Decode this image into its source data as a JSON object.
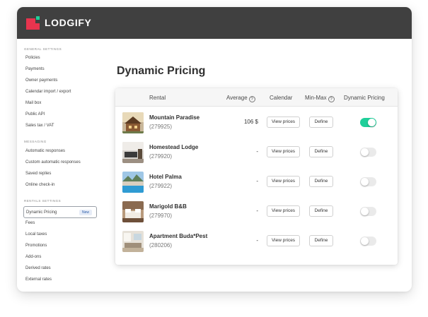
{
  "app": {
    "logo_text": "LODGIFY"
  },
  "sidebar": {
    "sections": [
      {
        "title": "General settings",
        "items": [
          "Policies",
          "Payments",
          "Owner payments",
          "Calendar import / export",
          "Mail box",
          "Public API",
          "Sales tax / VAT"
        ]
      },
      {
        "title": "Messaging",
        "items": [
          "Automatic responses",
          "Custom automatic responses",
          "Saved replies",
          "Online check-in"
        ]
      },
      {
        "title": "Rentals settings",
        "items": [
          "Dynamic Pricing",
          "Fees",
          "Local taxes",
          "Promotions",
          "Add-ons",
          "Derived rates",
          "External rates"
        ]
      }
    ],
    "active_item": "Dynamic Pricing",
    "new_badge": "New"
  },
  "page": {
    "title": "Dynamic Pricing"
  },
  "table": {
    "headers": {
      "rental": "Rental",
      "average": "Average",
      "calendar": "Calendar",
      "minmax": "Min-Max",
      "dynamic": "Dynamic Pricing"
    },
    "help_glyph": "?",
    "rows": [
      {
        "name": "Mountain Paradise",
        "id": "(279925)",
        "average": "106 $",
        "view_label": "View prices",
        "define_label": "Define",
        "dynamic_enabled": true,
        "thumb": "cabin-photo"
      },
      {
        "name": "Homestead Lodge",
        "id": "(279920)",
        "average": "-",
        "view_label": "View prices",
        "define_label": "Define",
        "dynamic_enabled": false,
        "thumb": "living-room-photo"
      },
      {
        "name": "Hotel Palma",
        "id": "(279922)",
        "average": "-",
        "view_label": "View prices",
        "define_label": "Define",
        "dynamic_enabled": false,
        "thumb": "pool-photo"
      },
      {
        "name": "Marigold B&B",
        "id": "(279970)",
        "average": "-",
        "view_label": "View prices",
        "define_label": "Define",
        "dynamic_enabled": false,
        "thumb": "bedroom-photo"
      },
      {
        "name": "Apartment Buda*Pest",
        "id": "(280206)",
        "average": "-",
        "view_label": "View prices",
        "define_label": "Define",
        "dynamic_enabled": false,
        "thumb": "apartment-photo"
      }
    ]
  },
  "colors": {
    "topbar": "#404040",
    "logo_red": "#e8344e",
    "logo_green": "#1fcf9a",
    "toggle_on": "#1fcf9a"
  }
}
